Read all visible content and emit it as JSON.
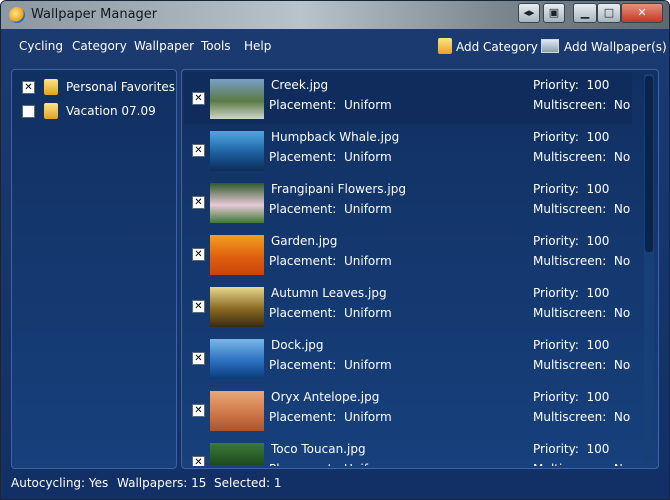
{
  "window": {
    "title": "Wallpaper Manager",
    "buttons": {
      "back": "◂▸",
      "restore_to_tray": "▣",
      "minimize": "▁",
      "maximize": "□",
      "close": "✕"
    }
  },
  "menu": [
    "Cycling",
    "Category",
    "Wallpaper",
    "Tools",
    "Help"
  ],
  "toolbar": {
    "add_category": "Add Category",
    "add_wallpapers": "Add Wallpaper(s)"
  },
  "categories": [
    {
      "label": "Personal Favorites",
      "checked": true
    },
    {
      "label": "Vacation 07.09",
      "checked": false
    }
  ],
  "wallpapers": [
    {
      "name": "Creek.jpg",
      "placement": "Uniform",
      "priority": "100",
      "multiscreen": "No",
      "checked": true,
      "selected": true,
      "thumb": [
        "#7aa0c8",
        "#5a7a44",
        "#cfd6c8"
      ]
    },
    {
      "name": "Humpback Whale.jpg",
      "placement": "Uniform",
      "priority": "100",
      "multiscreen": "No",
      "checked": true,
      "thumb": [
        "#4fa8e0",
        "#1d5fa0",
        "#0c2c58"
      ]
    },
    {
      "name": "Frangipani Flowers.jpg",
      "placement": "Uniform",
      "priority": "100",
      "multiscreen": "No",
      "checked": true,
      "thumb": [
        "#2e5a2a",
        "#e8c8d8",
        "#3d7a32"
      ]
    },
    {
      "name": "Garden.jpg",
      "placement": "Uniform",
      "priority": "100",
      "multiscreen": "No",
      "checked": true,
      "thumb": [
        "#f0a020",
        "#e06010",
        "#c84408"
      ]
    },
    {
      "name": "Autumn Leaves.jpg",
      "placement": "Uniform",
      "priority": "100",
      "multiscreen": "No",
      "checked": true,
      "thumb": [
        "#e8d890",
        "#8a6a22",
        "#3a2a10"
      ]
    },
    {
      "name": "Dock.jpg",
      "placement": "Uniform",
      "priority": "100",
      "multiscreen": "No",
      "checked": true,
      "thumb": [
        "#7ab8e8",
        "#2a70c0",
        "#0c3a78"
      ]
    },
    {
      "name": "Oryx Antelope.jpg",
      "placement": "Uniform",
      "priority": "100",
      "multiscreen": "No",
      "checked": true,
      "thumb": [
        "#e8a878",
        "#d07848",
        "#a85430"
      ]
    },
    {
      "name": "Toco Toucan.jpg",
      "placement": "Uniform",
      "priority": "100",
      "multiscreen": "No",
      "checked": true,
      "thumb": [
        "#3a7a3a",
        "#1e4a1e",
        "#e8a020"
      ]
    }
  ],
  "labels": {
    "placement": "Placement:",
    "priority": "Priority:",
    "multiscreen": "Multiscreen:"
  },
  "status": {
    "autocycling_label": "Autocycling:",
    "autocycling_value": "Yes",
    "wallpapers_label": "Wallpapers:",
    "wallpapers_value": "15",
    "selected_label": "Selected:",
    "selected_value": "1"
  },
  "check_mark": "✕"
}
